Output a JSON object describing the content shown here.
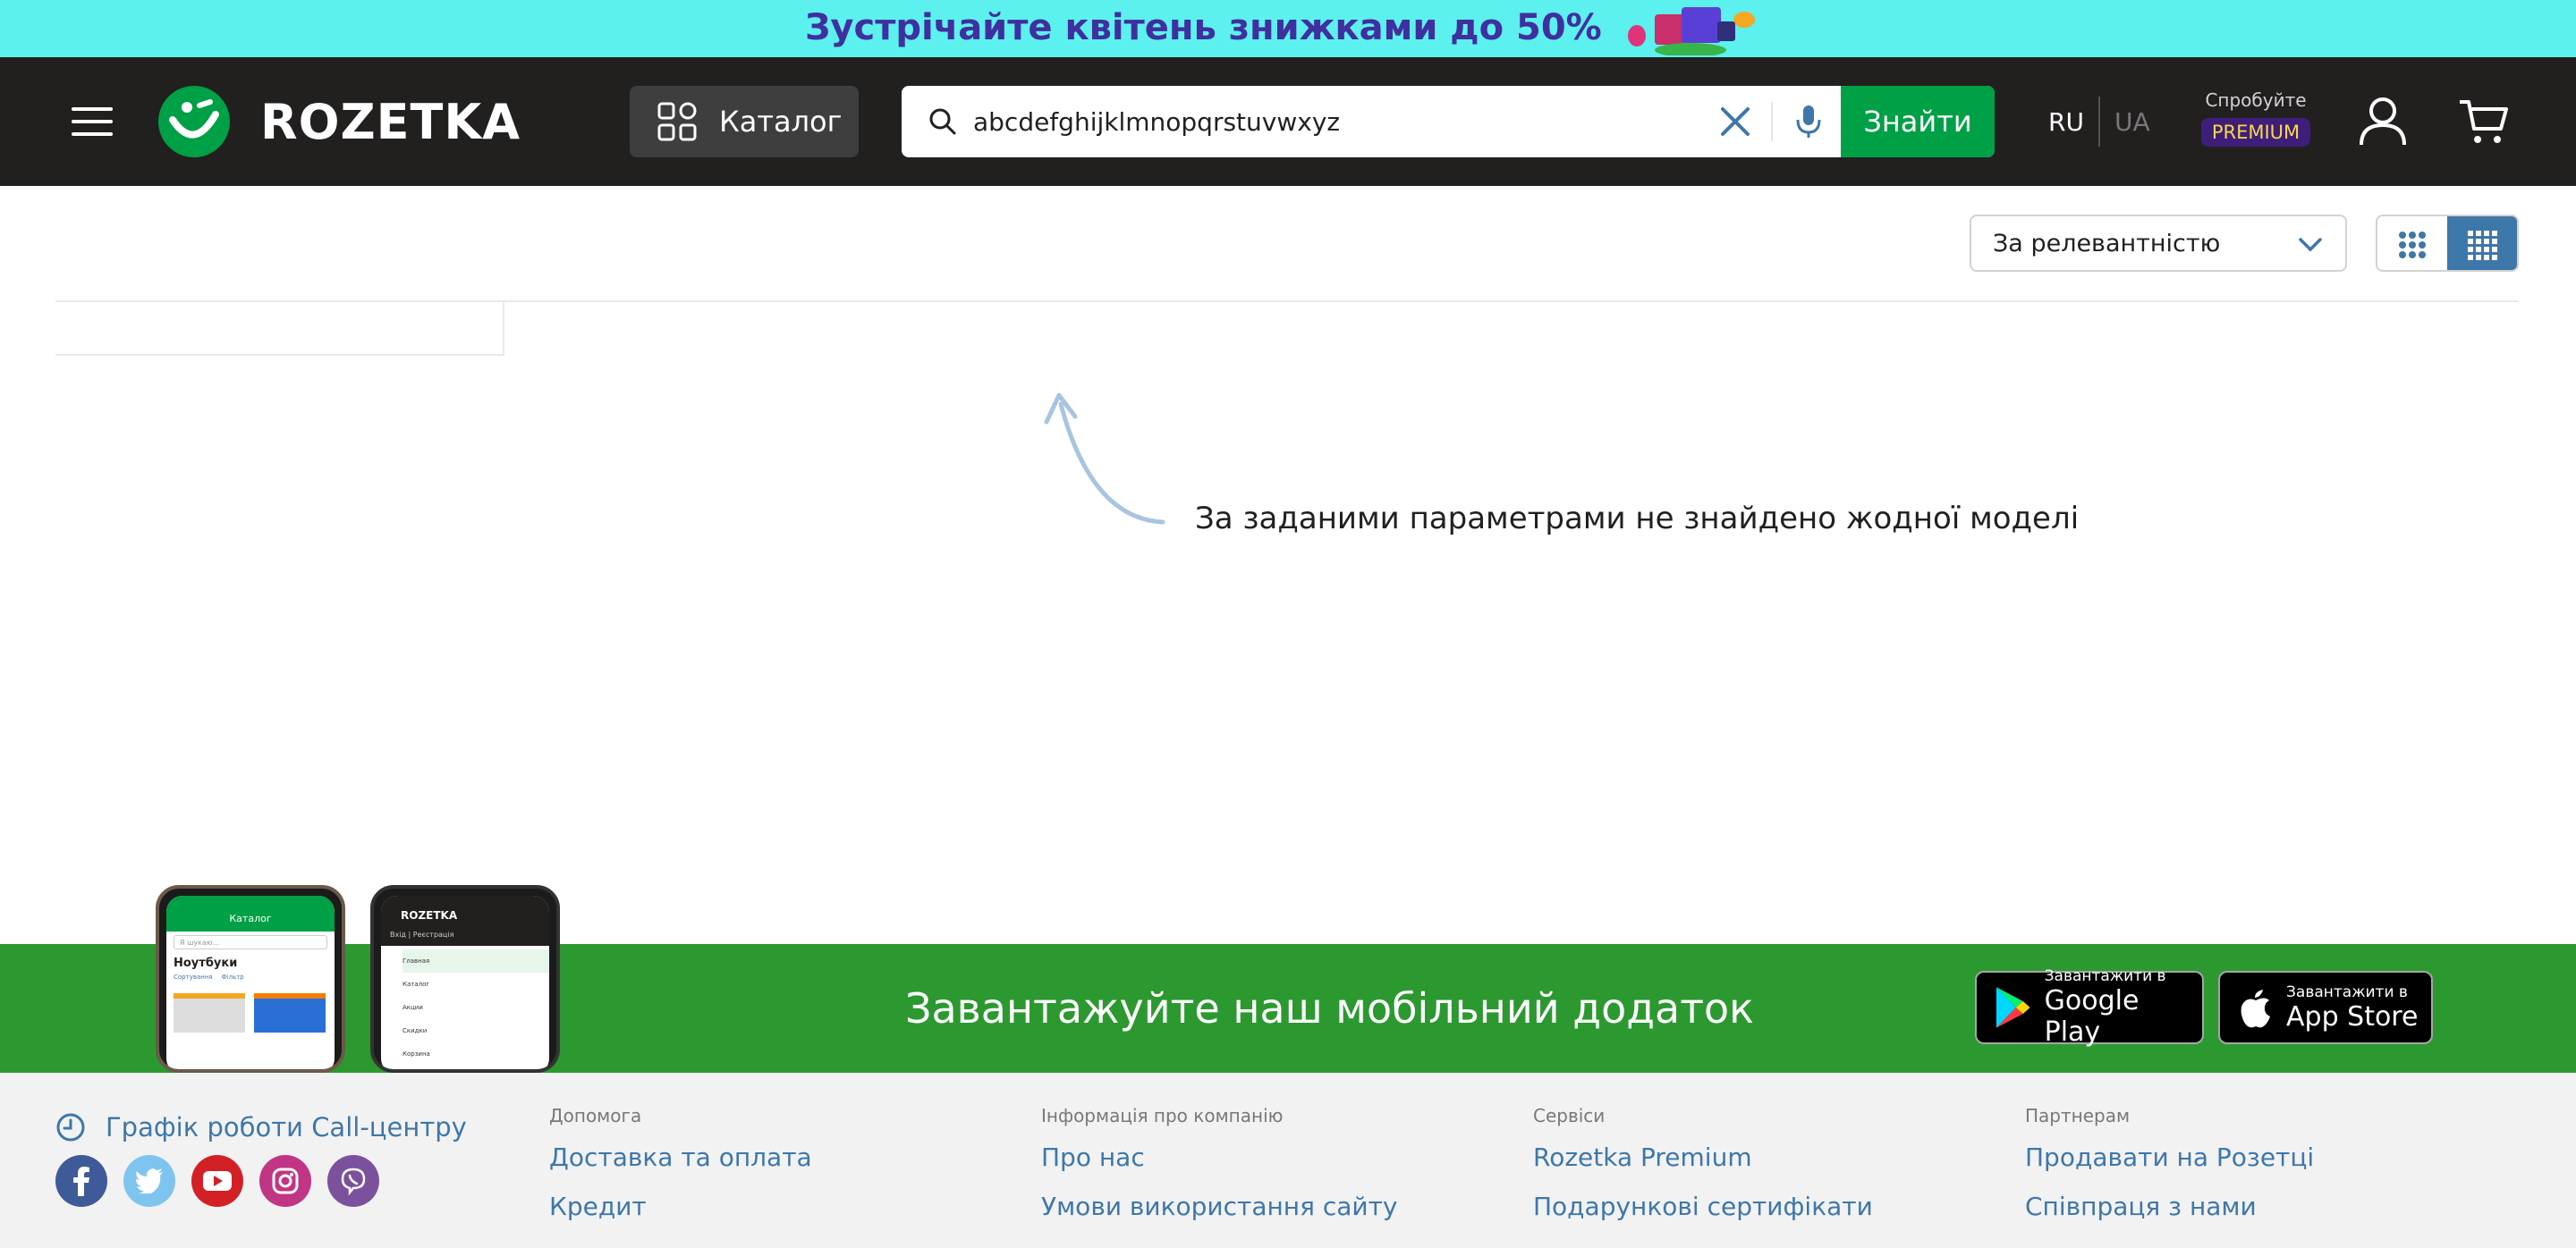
{
  "promo": {
    "text": "Зустрічайте квітень знижками до 50%"
  },
  "header": {
    "logo_text": "ROZETKA",
    "catalog_label": "Каталог",
    "search": {
      "value": "abcdefghijklmnopqrstuvwxyz",
      "submit_label": "Знайти"
    },
    "lang": {
      "ru": "RU",
      "ua": "UA"
    },
    "premium": {
      "try_label": "Спробуйте",
      "badge": "PREMIUM"
    }
  },
  "sort": {
    "selected": "За релевантністю"
  },
  "empty_state": {
    "message": "За заданими параметрами не знайдено жодної моделі"
  },
  "app_banner": {
    "title": "Завантажуйте наш мобільний додаток",
    "google_play": {
      "small": "Завантажити в",
      "big": "Google Play"
    },
    "app_store": {
      "small": "Завантажити в",
      "big": "App Store"
    },
    "phone1": {
      "header": "Каталог",
      "search": "Я шукаю...",
      "section": "Ноутбуки",
      "filters": [
        "Сортування",
        "Фільтр"
      ]
    },
    "phone2": {
      "logo": "ROZETKA",
      "auth": "Вхід | Реєстрація",
      "menu": [
        "Главная",
        "Каталог",
        "Акции",
        "Скидки",
        "Корзина"
      ]
    }
  },
  "footer": {
    "callcenter_label": "Графік роботи Call-центру",
    "columns": [
      {
        "title": "Допомога",
        "links": [
          "Доставка та оплата",
          "Кредит"
        ]
      },
      {
        "title": "Інформація про компанію",
        "links": [
          "Про нас",
          "Умови використання сайту"
        ]
      },
      {
        "title": "Сервіси",
        "links": [
          "Rozetka Premium",
          "Подарункові сертифікати"
        ]
      },
      {
        "title": "Партнерам",
        "links": [
          "Продавати на Розетці",
          "Співпраця з нами"
        ]
      }
    ]
  },
  "colors": {
    "header_bg": "#221f1f",
    "promo_bg": "#5cf0ee",
    "accent_green": "#00a046",
    "banner_green": "#2c9930",
    "link_blue": "#3e77aa",
    "footer_bg": "#f2f2f2"
  },
  "icons": [
    "menu-icon",
    "rozetka-smile-logo",
    "catalog-grid-icon",
    "search-icon",
    "clear-icon",
    "microphone-icon",
    "user-icon",
    "cart-icon",
    "chevron-down-icon",
    "grid-large-icon",
    "grid-small-icon",
    "curved-arrow-icon",
    "clock-icon",
    "facebook-icon",
    "twitter-icon",
    "youtube-icon",
    "instagram-icon",
    "viber-icon",
    "google-play-icon",
    "apple-icon"
  ]
}
